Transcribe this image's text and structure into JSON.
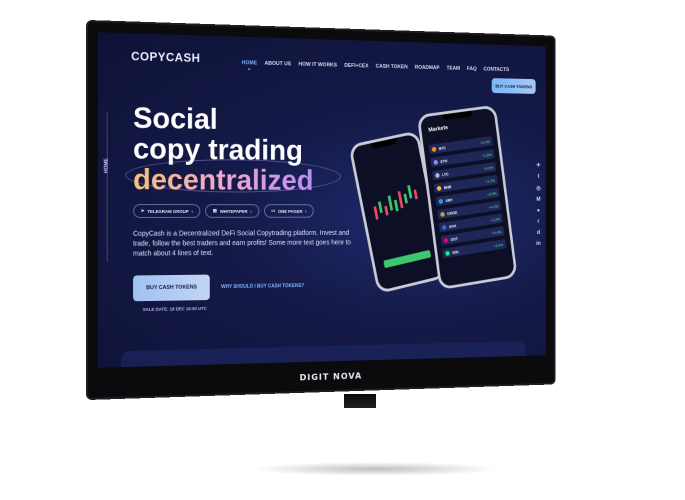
{
  "brand": {
    "logo_text": "COPYCASH",
    "monitor_brand": "DIGIT NOVA"
  },
  "nav": {
    "items": [
      {
        "label": "HOME",
        "active": true
      },
      {
        "label": "ABOUT US",
        "active": false
      },
      {
        "label": "HOW IT WORKS",
        "active": false
      },
      {
        "label": "DEFI+CEX",
        "active": false
      },
      {
        "label": "CASH TOKEN",
        "active": false
      },
      {
        "label": "ROADMAP",
        "active": false
      },
      {
        "label": "TEAM",
        "active": false
      },
      {
        "label": "FAQ",
        "active": false
      },
      {
        "label": "CONTACTS",
        "active": false
      }
    ],
    "buy_button": "BUY CASH TOKENS"
  },
  "hero": {
    "line1": "Social",
    "line2": "copy trading",
    "line3": "decentralized",
    "chips": [
      {
        "label": "TELEGRAM GROUP",
        "icon": "telegram-icon"
      },
      {
        "label": "WHITEPAPER",
        "icon": "document-icon"
      },
      {
        "label": "ONE PAGER",
        "icon": "page-icon"
      }
    ],
    "description": "CopyCash is a Decentralized DeFi Social Copytrading platform. Invest and trade, follow the best traders and earn profits! Some more text goes here to match about 4 lines of text.",
    "buy_button": "BUY CASH TOKENS",
    "why_link": "WHY SHOULD I BUY CASH TOKENS?",
    "sale_date": "SALE DATE: 18 DEC 16:00 UTC"
  },
  "side_label": "HOME",
  "social_icons": [
    "telegram-icon",
    "twitter-icon",
    "instagram-icon",
    "medium-icon",
    "github-icon",
    "reddit-icon",
    "discord-icon",
    "linkedin-icon"
  ],
  "phone": {
    "title": "Markets",
    "markets": [
      {
        "coin": "BTC",
        "change": "+2.4%",
        "color": "#f7931a"
      },
      {
        "coin": "ETH",
        "change": "+1.8%",
        "color": "#8c8cff"
      },
      {
        "coin": "LTC",
        "change": "+0.6%",
        "color": "#b8b8c8"
      },
      {
        "coin": "BNB",
        "change": "+3.1%",
        "color": "#f3ba2f"
      },
      {
        "coin": "XRP",
        "change": "+0.9%",
        "color": "#2a9df4"
      },
      {
        "coin": "DOGE",
        "change": "+4.2%",
        "color": "#c2a633"
      },
      {
        "coin": "ADA",
        "change": "+1.2%",
        "color": "#3468d1"
      },
      {
        "coin": "DOT",
        "change": "+0.4%",
        "color": "#e6007a"
      },
      {
        "coin": "SOL",
        "change": "+2.0%",
        "color": "#14f195"
      }
    ]
  },
  "colors": {
    "background": "#0e1236",
    "accent": "#6fb4ff",
    "gradient_start": "#f3c27a",
    "gradient_end": "#b88ef5"
  }
}
